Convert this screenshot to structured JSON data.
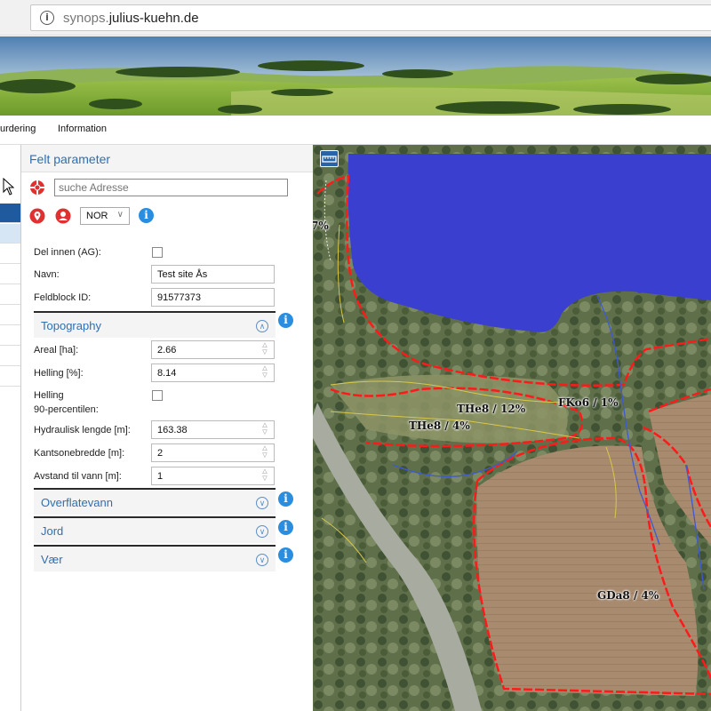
{
  "browser": {
    "url_prefix": "synops.",
    "url_domain": "julius-kuehn.de",
    "info_icon": "info-circle-icon"
  },
  "nav": {
    "items": [
      "urdering",
      "Information"
    ]
  },
  "panel": {
    "title": "Felt parameter",
    "address_placeholder": "suche Adresse",
    "projection": "NOR",
    "fields": {
      "del_innen_label": "Del innen (AG):",
      "navn_label": "Navn:",
      "navn_value": "Test site Ås",
      "feldblock_label": "Feldblock ID:",
      "feldblock_value": "91577373"
    },
    "topography": {
      "title": "Topography",
      "areal_label": "Areal [ha]:",
      "areal_value": "2.66",
      "helling_label": "Helling [%]:",
      "helling_value": "8.14",
      "helling90_label_1": "Helling",
      "helling90_label_2": "90-percentilen:",
      "hydraulisk_label": "Hydraulisk lengde [m]:",
      "hydraulisk_value": "163.38",
      "kantsone_label": "Kantsonebredde [m]:",
      "kantsone_value": "2",
      "avstand_label": "Avstand til vann [m]:",
      "avstand_value": "1"
    },
    "sections": [
      "Overflatevann",
      "Jord",
      "Vær"
    ]
  },
  "map": {
    "labels": [
      "7%",
      "THe8 / 12%",
      "FKo6 / 1%",
      "THe8 / 4%",
      "GDa8 / 4%"
    ]
  },
  "colors": {
    "accent_blue": "#2f6fb0",
    "info_blue": "#2b8de0",
    "water": "#3a3fd0",
    "field_outline_red": "#ff1a1a",
    "icon_red": "#e03030"
  }
}
